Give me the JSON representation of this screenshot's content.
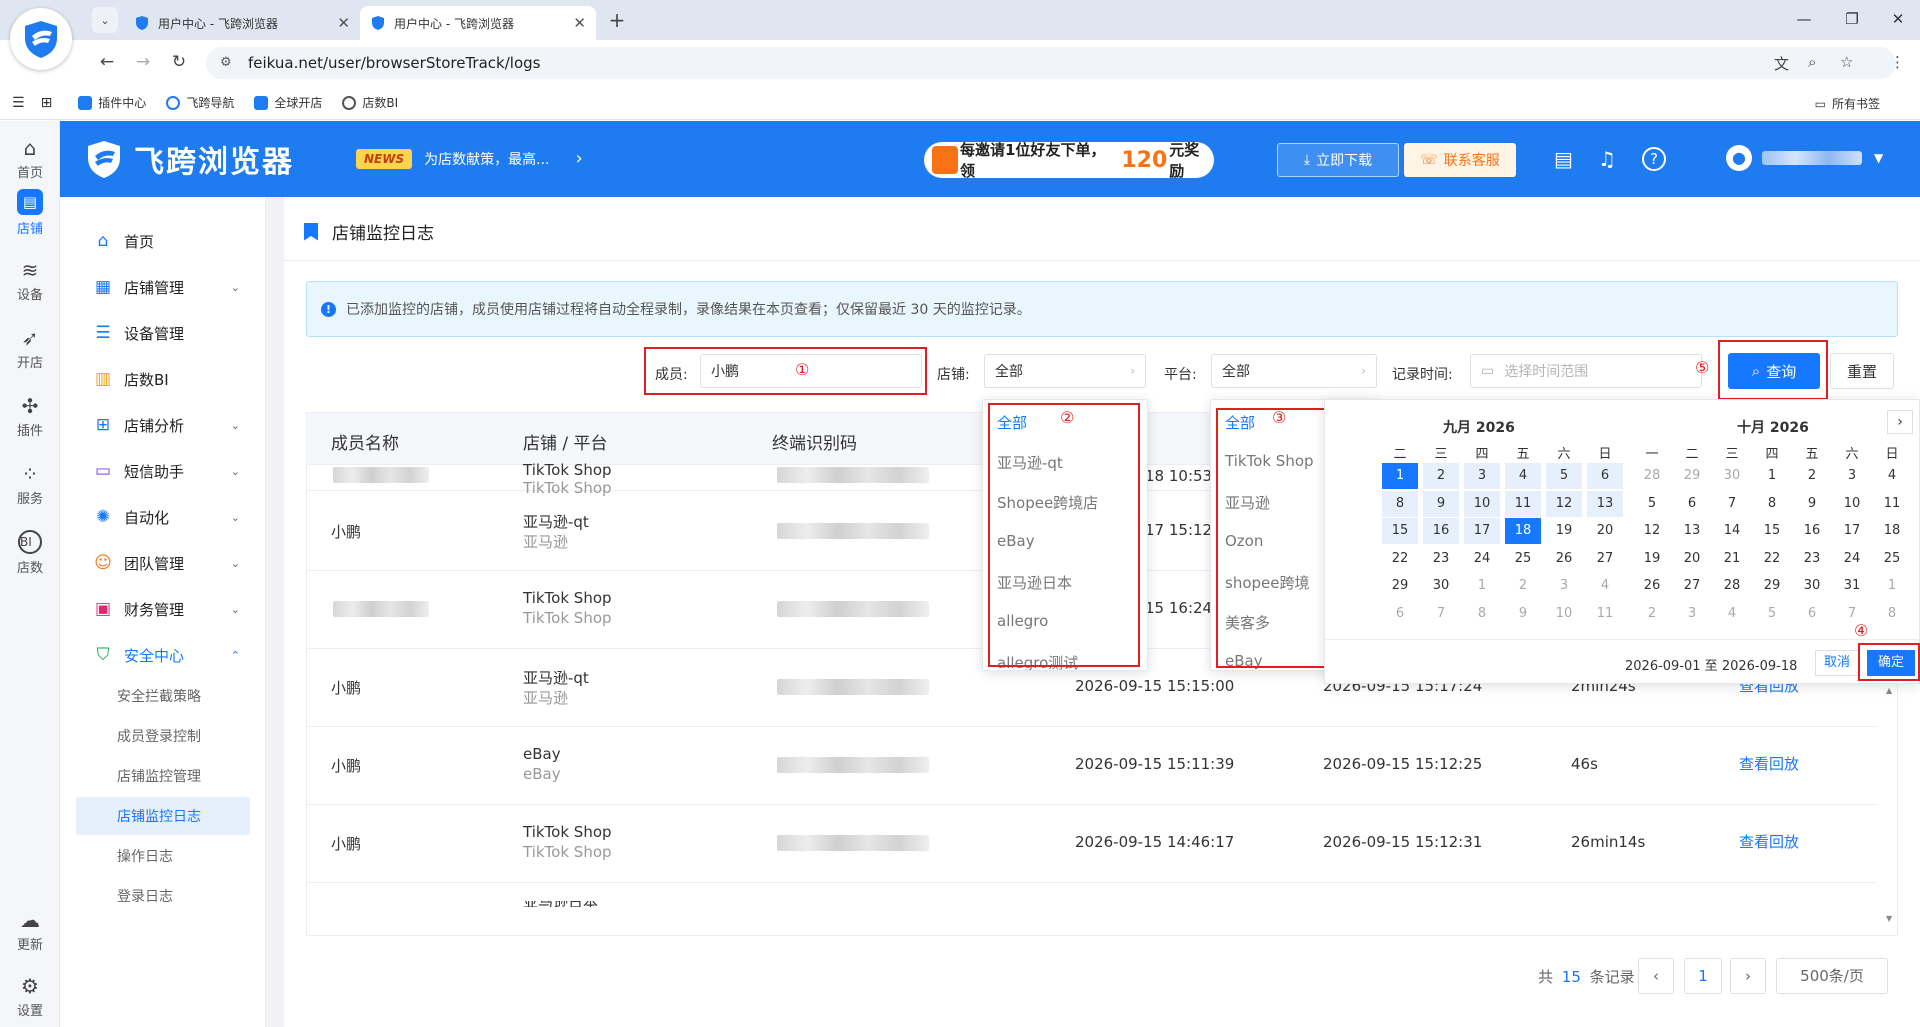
{
  "browser": {
    "tabs": [
      {
        "title": "用户中心 - 飞跨浏览器",
        "active": false
      },
      {
        "title": "用户中心 - 飞跨浏览器",
        "active": true
      }
    ],
    "url": "feikua.net/user/browserStoreTrack/logs",
    "bookmarks": [
      "插件中心",
      "飞跨导航",
      "全球开店",
      "店数BI"
    ],
    "bookmarks_right": "所有书签"
  },
  "rail": {
    "items": [
      {
        "label": "首页",
        "icon": "home-icon"
      },
      {
        "label": "店铺",
        "icon": "store-icon",
        "active": true
      },
      {
        "label": "设备",
        "icon": "layers-icon"
      },
      {
        "label": "开店",
        "icon": "rocket-icon"
      },
      {
        "label": "插件",
        "icon": "puzzle-icon"
      },
      {
        "label": "服务",
        "icon": "grid-icon"
      },
      {
        "label": "店数",
        "icon": "bi-icon"
      }
    ],
    "bottom": [
      {
        "label": "更新",
        "icon": "cloud-icon"
      },
      {
        "label": "设置",
        "icon": "settings-icon"
      }
    ]
  },
  "header": {
    "brand": "飞跨浏览器",
    "news_tag": "NEWS",
    "news_text": "为店数献策，最高...",
    "promo_pre": "每邀请1位好友下单，领",
    "promo_num": "120",
    "promo_post": "元奖励",
    "download": "立即下载",
    "support": "联系客服"
  },
  "menu": {
    "items": [
      {
        "label": "首页"
      },
      {
        "label": "店铺管理"
      },
      {
        "label": "设备管理"
      },
      {
        "label": "店数BI"
      },
      {
        "label": "店铺分析"
      },
      {
        "label": "短信助手"
      },
      {
        "label": "自动化"
      },
      {
        "label": "团队管理"
      },
      {
        "label": "财务管理"
      },
      {
        "label": "安全中心"
      }
    ],
    "sub": [
      "安全拦截策略",
      "成员登录控制",
      "店铺监控管理",
      "店铺监控日志",
      "操作日志",
      "登录日志"
    ]
  },
  "page": {
    "title": "店铺监控日志",
    "notice": "已添加监控的店铺，成员使用店铺过程将自动全程录制，录像结果在本页查看；仅保留最近 30 天的监控记录。"
  },
  "filters": {
    "member_label": "成员:",
    "member_value": "小鹏",
    "store_label": "店铺:",
    "store_value": "全部",
    "platform_label": "平台:",
    "platform_value": "全部",
    "time_label": "记录时间:",
    "time_placeholder": "选择时间范围",
    "query": "查询",
    "reset": "重置"
  },
  "annotations": [
    "①",
    "②",
    "③",
    "④",
    "⑤"
  ],
  "table": {
    "headers": [
      "成员名称",
      "店铺 / 平台",
      "终端识别码"
    ],
    "rows": [
      {
        "member": "",
        "store": "TikTok Shop",
        "platform": "TikTok Shop",
        "start": "18 10:53:",
        "end": "",
        "duration": "",
        "action": ""
      },
      {
        "member": "小鹏",
        "store": "亚马逊-qt",
        "platform": "亚马逊",
        "start": "17 15:12:",
        "end": "",
        "duration": "",
        "action": ""
      },
      {
        "member": "",
        "store": "TikTok Shop",
        "platform": "TikTok Shop",
        "start": "15 16:24:",
        "end": "",
        "duration": "",
        "action": ""
      },
      {
        "member": "小鹏",
        "store": "亚马逊-qt",
        "platform": "亚马逊",
        "start": "2026-09-15 15:15:00",
        "end": "2026-09-15 15:17:24",
        "duration": "2min24s",
        "action": "查看回放"
      },
      {
        "member": "小鹏",
        "store": "eBay",
        "platform": "eBay",
        "start": "2026-09-15 15:11:39",
        "end": "2026-09-15 15:12:25",
        "duration": "46s",
        "action": "查看回放"
      },
      {
        "member": "小鹏",
        "store": "TikTok Shop",
        "platform": "TikTok Shop",
        "start": "2026-09-15 14:46:17",
        "end": "2026-09-15 15:12:31",
        "duration": "26min14s",
        "action": "查看回放"
      }
    ],
    "partial_row": "亚马逊日本"
  },
  "store_dropdown": [
    "全部",
    "亚马逊-qt",
    "Shopee跨境店",
    "eBay",
    "亚马逊日本",
    "allegro",
    "allegro测试"
  ],
  "platform_dropdown": [
    "全部",
    "TikTok Shop",
    "亚马逊",
    "Ozon",
    "shopee跨境",
    "美客多",
    "eBay"
  ],
  "datepicker": {
    "left_title": "九月 2026",
    "right_title": "十月 2026",
    "weekdays": [
      "二",
      "三",
      "四",
      "五",
      "六",
      "日"
    ],
    "weekdays_full": [
      "一",
      "二",
      "三",
      "四",
      "五",
      "六",
      "日"
    ],
    "left_rows": [
      [
        "1",
        "2",
        "3",
        "4",
        "5",
        "6"
      ],
      [
        "8",
        "9",
        "10",
        "11",
        "12",
        "13"
      ],
      [
        "15",
        "16",
        "17",
        "18",
        "19",
        "20"
      ],
      [
        "22",
        "23",
        "24",
        "25",
        "26",
        "27"
      ],
      [
        "29",
        "30",
        "1",
        "2",
        "3",
        "4"
      ],
      [
        "6",
        "7",
        "8",
        "9",
        "10",
        "11"
      ]
    ],
    "right_rows": [
      [
        "28",
        "29",
        "30",
        "1",
        "2",
        "3",
        "4"
      ],
      [
        "5",
        "6",
        "7",
        "8",
        "9",
        "10",
        "11"
      ],
      [
        "12",
        "13",
        "14",
        "15",
        "16",
        "17",
        "18"
      ],
      [
        "19",
        "20",
        "21",
        "22",
        "23",
        "24",
        "25"
      ],
      [
        "26",
        "27",
        "28",
        "29",
        "30",
        "31",
        "1"
      ],
      [
        "2",
        "3",
        "4",
        "5",
        "6",
        "7",
        "8"
      ]
    ],
    "range_text": "2026-09-01 至 2026-09-18",
    "cancel": "取消",
    "confirm": "确定"
  },
  "pagination": {
    "total_pre": "共",
    "total": "15",
    "total_post": "条记录",
    "page": "1",
    "page_size": "500条/页"
  },
  "colors": {
    "primary": "#1677ff",
    "header": "#1e7cf0",
    "annotation": "#e02020"
  }
}
